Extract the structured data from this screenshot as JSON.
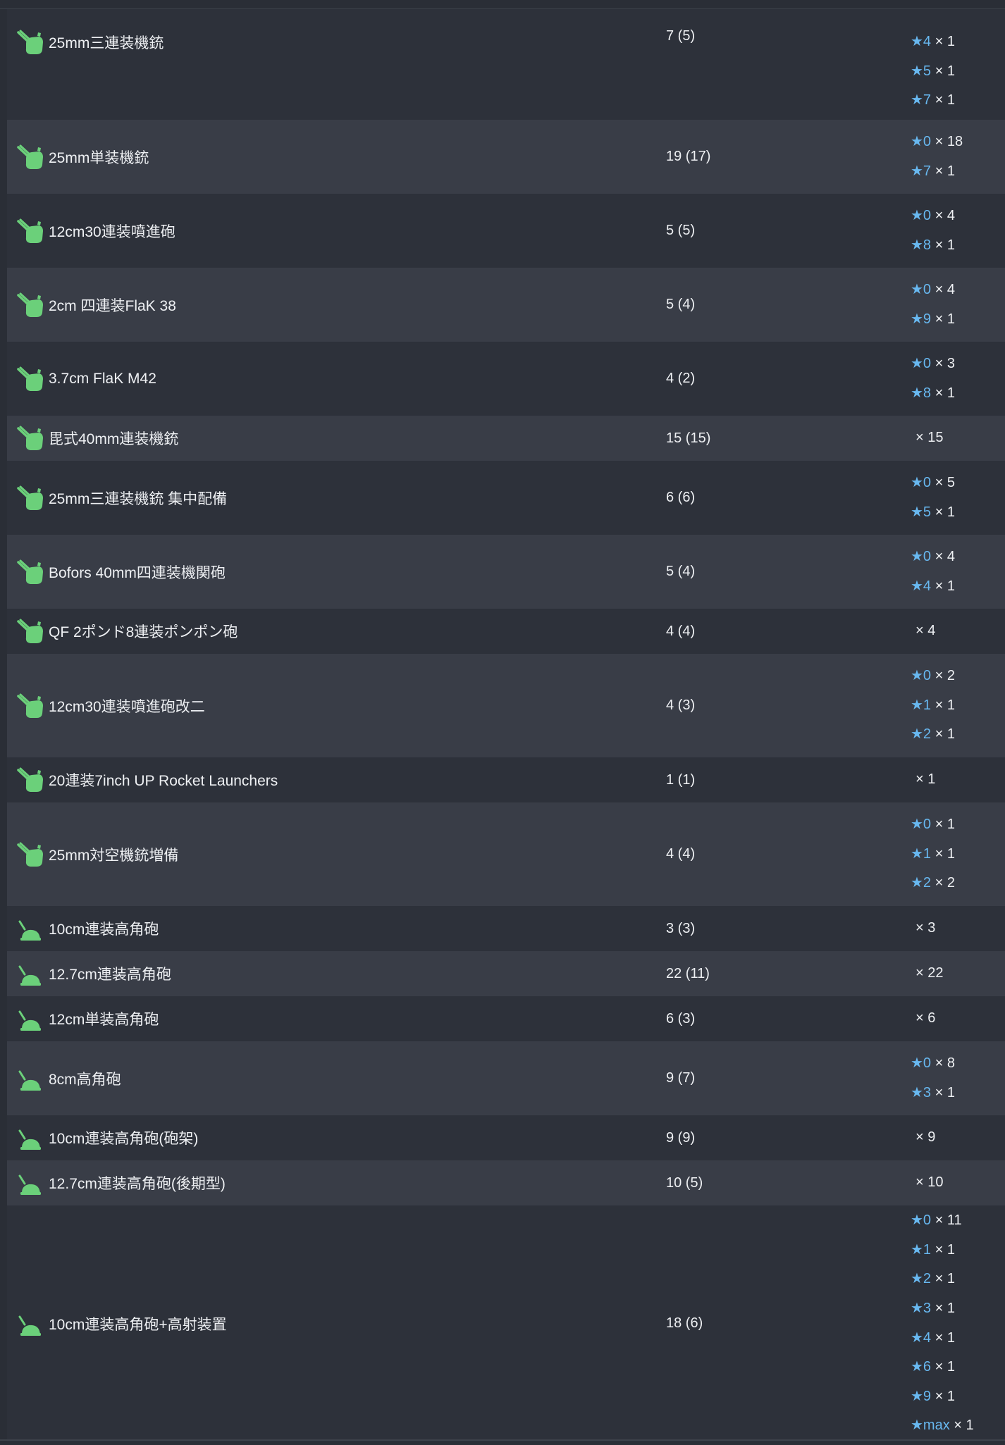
{
  "colors": {
    "background": "#2a2e36",
    "row_dark": "#2d313a",
    "row_light": "#393d47",
    "star_blue": "#68b8f0",
    "icon_green": "#6bd07a"
  },
  "rows": [
    {
      "name": "25mm三連装機銃",
      "count": "7 (5)",
      "icon": "aa-gun-icon",
      "stars": [
        {
          "level": "★4",
          "times": "× 1"
        },
        {
          "level": "★5",
          "times": "× 1"
        },
        {
          "level": "★7",
          "times": "× 1"
        }
      ]
    },
    {
      "name": "25mm単装機銃",
      "count": "19 (17)",
      "icon": "aa-gun-icon",
      "stars": [
        {
          "level": "★0",
          "times": "× 18"
        },
        {
          "level": "★7",
          "times": "× 1"
        }
      ]
    },
    {
      "name": "12cm30連装噴進砲",
      "count": "5 (5)",
      "icon": "aa-gun-icon",
      "stars": [
        {
          "level": "★0",
          "times": "× 4"
        },
        {
          "level": "★8",
          "times": "× 1"
        }
      ]
    },
    {
      "name": "2cm 四連装FlaK 38",
      "count": "5 (4)",
      "icon": "aa-gun-icon",
      "stars": [
        {
          "level": "★0",
          "times": "× 4"
        },
        {
          "level": "★9",
          "times": "× 1"
        }
      ]
    },
    {
      "name": "3.7cm FlaK M42",
      "count": "4 (2)",
      "icon": "aa-gun-icon",
      "stars": [
        {
          "level": "★0",
          "times": "× 3"
        },
        {
          "level": "★8",
          "times": "× 1"
        }
      ]
    },
    {
      "name": "毘式40mm連装機銃",
      "count": "15 (15)",
      "icon": "aa-gun-icon",
      "stars": [
        {
          "level": "",
          "times": "× 15"
        }
      ]
    },
    {
      "name": "25mm三連装機銃 集中配備",
      "count": "6 (6)",
      "icon": "aa-gun-icon",
      "stars": [
        {
          "level": "★0",
          "times": "× 5"
        },
        {
          "level": "★5",
          "times": "× 1"
        }
      ]
    },
    {
      "name": "Bofors 40mm四連装機関砲",
      "count": "5 (4)",
      "icon": "aa-gun-icon",
      "stars": [
        {
          "level": "★0",
          "times": "× 4"
        },
        {
          "level": "★4",
          "times": "× 1"
        }
      ]
    },
    {
      "name": "QF 2ポンド8連装ポンポン砲",
      "count": "4 (4)",
      "icon": "aa-gun-icon",
      "stars": [
        {
          "level": "",
          "times": "× 4"
        }
      ]
    },
    {
      "name": "12cm30連装噴進砲改二",
      "count": "4 (3)",
      "icon": "aa-gun-icon",
      "stars": [
        {
          "level": "★0",
          "times": "× 2"
        },
        {
          "level": "★1",
          "times": "× 1"
        },
        {
          "level": "★2",
          "times": "× 1"
        }
      ]
    },
    {
      "name": "20連装7inch UP Rocket Launchers",
      "count": "1 (1)",
      "icon": "aa-gun-icon",
      "stars": [
        {
          "level": "",
          "times": "× 1"
        }
      ]
    },
    {
      "name": "25mm対空機銃増備",
      "count": "4 (4)",
      "icon": "aa-gun-icon",
      "stars": [
        {
          "level": "★0",
          "times": "× 1"
        },
        {
          "level": "★1",
          "times": "× 1"
        },
        {
          "level": "★2",
          "times": "× 2"
        }
      ]
    },
    {
      "name": "10cm連装高角砲",
      "count": "3 (3)",
      "icon": "high-angle-gun-icon",
      "stars": [
        {
          "level": "",
          "times": "× 3"
        }
      ]
    },
    {
      "name": "12.7cm連装高角砲",
      "count": "22 (11)",
      "icon": "high-angle-gun-icon",
      "stars": [
        {
          "level": "",
          "times": "× 22"
        }
      ]
    },
    {
      "name": "12cm単装高角砲",
      "count": "6 (3)",
      "icon": "high-angle-gun-icon",
      "stars": [
        {
          "level": "",
          "times": "× 6"
        }
      ]
    },
    {
      "name": "8cm高角砲",
      "count": "9 (7)",
      "icon": "high-angle-gun-icon",
      "stars": [
        {
          "level": "★0",
          "times": "× 8"
        },
        {
          "level": "★3",
          "times": "× 1"
        }
      ]
    },
    {
      "name": "10cm連装高角砲(砲架)",
      "count": "9 (9)",
      "icon": "high-angle-gun-icon",
      "stars": [
        {
          "level": "",
          "times": "× 9"
        }
      ]
    },
    {
      "name": "12.7cm連装高角砲(後期型)",
      "count": "10 (5)",
      "icon": "high-angle-gun-icon",
      "stars": [
        {
          "level": "",
          "times": "× 10"
        }
      ]
    },
    {
      "name": "10cm連装高角砲+高射装置",
      "count": "18 (6)",
      "icon": "high-angle-gun-icon",
      "stars": [
        {
          "level": "★0",
          "times": "× 11"
        },
        {
          "level": "★1",
          "times": "× 1"
        },
        {
          "level": "★2",
          "times": "× 1"
        },
        {
          "level": "★3",
          "times": "× 1"
        },
        {
          "level": "★4",
          "times": "× 1"
        },
        {
          "level": "★6",
          "times": "× 1"
        },
        {
          "level": "★9",
          "times": "× 1"
        },
        {
          "level": "★max",
          "times": "× 1"
        }
      ]
    }
  ]
}
